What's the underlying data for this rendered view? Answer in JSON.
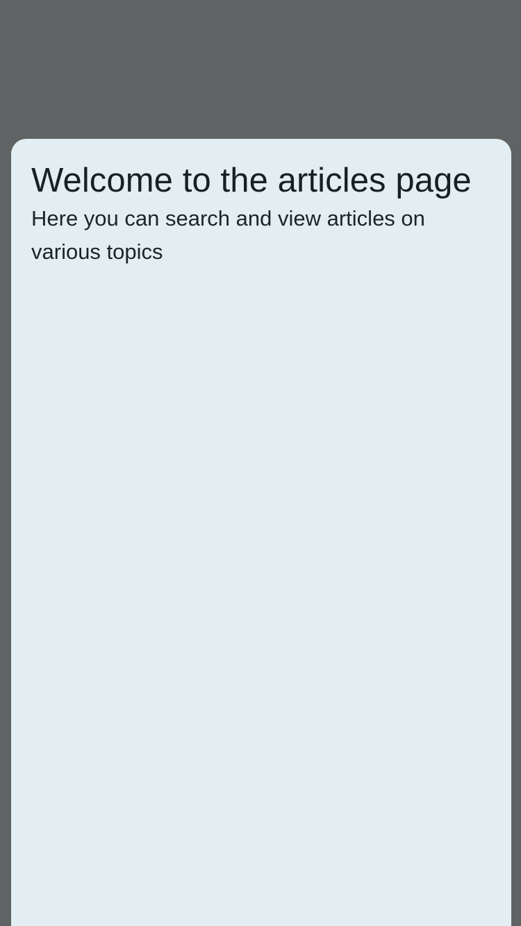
{
  "sheet": {
    "title": "Welcome to the articles page",
    "subtitle": "Here you can search and view articles on various topics"
  },
  "colors": {
    "backdrop": "#5f6364",
    "sheet_background": "#e2eef1",
    "text": "#172124"
  }
}
